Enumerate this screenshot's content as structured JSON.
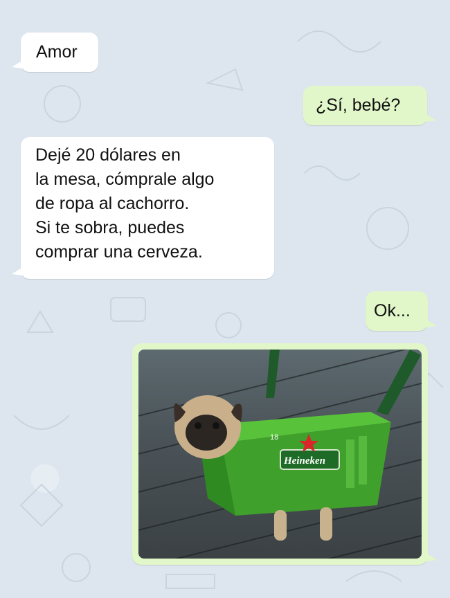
{
  "messages": [
    {
      "id": "m1",
      "direction": "incoming",
      "text": "Amor"
    },
    {
      "id": "m2",
      "direction": "outgoing",
      "text": "¿Sí, bebé?"
    },
    {
      "id": "m3",
      "direction": "incoming",
      "text": "Dejé 20 dólares en\nla mesa, cómprale algo\nde ropa al cachorro.\nSi te sobra, puedes\ncomprar una cerveza."
    },
    {
      "id": "m4",
      "direction": "outgoing",
      "text": "Ok..."
    }
  ],
  "photo": {
    "description_icon": "pug-in-beer-box-image",
    "box_brand": "Heineken",
    "box_count": "18"
  },
  "colors": {
    "incoming": "#ffffff",
    "outgoing": "#e1f7c9",
    "background": "#dde6ee",
    "box_green": "#3fa12b"
  }
}
